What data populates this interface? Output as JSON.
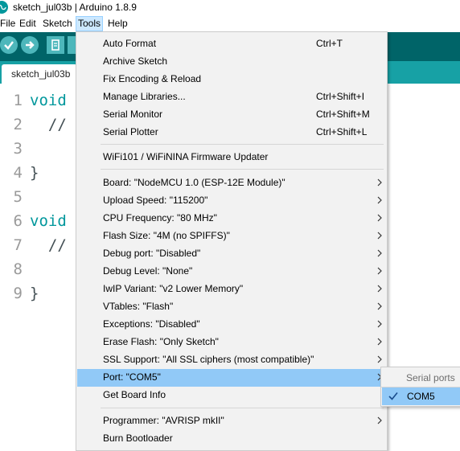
{
  "window": {
    "title": "sketch_jul03b | Arduino 1.8.9"
  },
  "menubar": {
    "items": [
      "File",
      "Edit",
      "Sketch",
      "Tools",
      "Help"
    ],
    "active": "Tools"
  },
  "toolbar": {
    "buttons": [
      "verify-icon",
      "upload-icon",
      "new-icon",
      "open-icon"
    ]
  },
  "tab": {
    "label": "sketch_jul03b"
  },
  "editor": {
    "line_numbers": [
      "1",
      "2",
      "3",
      "4",
      "5",
      "6",
      "7",
      "8",
      "9"
    ],
    "lines": [
      {
        "kw": "void",
        "text": ""
      },
      {
        "kw": "",
        "text": "  //"
      },
      {
        "kw": "",
        "text": ""
      },
      {
        "kw": "",
        "text": "}"
      },
      {
        "kw": "",
        "text": ""
      },
      {
        "kw": "void",
        "text": ""
      },
      {
        "kw": "",
        "text": "  //"
      },
      {
        "kw": "",
        "text": ""
      },
      {
        "kw": "",
        "text": "}"
      }
    ]
  },
  "tools_menu": {
    "items": [
      {
        "label": "Auto Format",
        "shortcut": "Ctrl+T"
      },
      {
        "label": "Archive Sketch",
        "shortcut": ""
      },
      {
        "label": "Fix Encoding & Reload",
        "shortcut": ""
      },
      {
        "label": "Manage Libraries...",
        "shortcut": "Ctrl+Shift+I"
      },
      {
        "label": "Serial Monitor",
        "shortcut": "Ctrl+Shift+M"
      },
      {
        "label": "Serial Plotter",
        "shortcut": "Ctrl+Shift+L"
      },
      {
        "label": "WiFi101 / WiFiNINA Firmware Updater",
        "shortcut": ""
      },
      {
        "label": "Board: \"NodeMCU 1.0 (ESP-12E Module)\"",
        "submenu": true
      },
      {
        "label": "Upload Speed: \"115200\"",
        "submenu": true
      },
      {
        "label": "CPU Frequency: \"80 MHz\"",
        "submenu": true
      },
      {
        "label": "Flash Size: \"4M (no SPIFFS)\"",
        "submenu": true
      },
      {
        "label": "Debug port: \"Disabled\"",
        "submenu": true
      },
      {
        "label": "Debug Level: \"None\"",
        "submenu": true
      },
      {
        "label": "IwIP Variant: \"v2 Lower Memory\"",
        "submenu": true
      },
      {
        "label": "VTables: \"Flash\"",
        "submenu": true
      },
      {
        "label": "Exceptions: \"Disabled\"",
        "submenu": true
      },
      {
        "label": "Erase Flash: \"Only Sketch\"",
        "submenu": true
      },
      {
        "label": "SSL Support: \"All SSL ciphers (most compatible)\"",
        "submenu": true
      },
      {
        "label": "Port: \"COM5\"",
        "submenu": true,
        "highlighted": true
      },
      {
        "label": "Get Board Info",
        "shortcut": ""
      },
      {
        "label": "Programmer: \"AVRISP mkII\"",
        "submenu": true
      },
      {
        "label": "Burn Bootloader",
        "shortcut": ""
      }
    ]
  },
  "port_submenu": {
    "header": "Serial ports",
    "items": [
      {
        "label": "COM5",
        "checked": true
      }
    ]
  },
  "colors": {
    "teal_dark": "#006468",
    "teal": "#17a1a5",
    "highlight": "#91c9f7",
    "keyword": "#00979c"
  }
}
